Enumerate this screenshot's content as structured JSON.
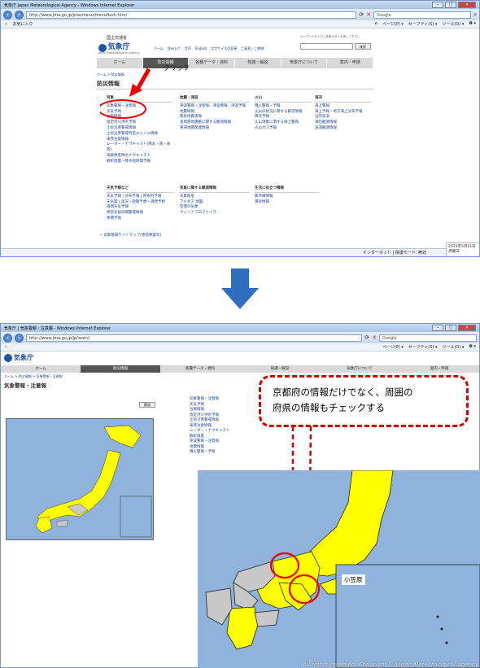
{
  "window1": {
    "title": "気象庁 Japan Meteorological Agency - Windows Internet Explorer",
    "url": "http://www.jma.go.jp/jma/menu/menuflash.html",
    "search_placeholder": "Google",
    "fav_label": "お気に入り",
    "toolbar": [
      "ページ(P) ▾",
      "セーフティ(S) ▾",
      "ツール(O) ▾",
      "❷ ▾"
    ],
    "agency_small": "国土交通省",
    "agency_name": "気象庁",
    "agency_en": "Japan Meteorological Agency",
    "top_links": [
      "ホーム",
      "読み上げ",
      "音声",
      "English",
      "文字サイズの変更",
      "ご意見・ご感想",
      "サイトマップ"
    ],
    "search_hint": "キーワードを入力し検索ボタンを押して下さい",
    "search_button": "検索",
    "menu": [
      "ホーム",
      "防災情報",
      "各種データ・資料",
      "知識・解説",
      "気象庁について",
      "案内・申請"
    ],
    "breadcrumb": "ホーム > 防災情報",
    "page_heading": "防災情報",
    "sections": {
      "weather": {
        "title": "気象",
        "items": [
          "気象警報・注意報",
          "天気予報",
          "台風情報",
          "指定河川洪水予報",
          "土砂災害警戒情報",
          "土砂災害警戒判定メッシュ情報",
          "竜巻注意情報",
          "レーダー・ナウキャスト(降水・雷・竜巻)",
          "高解像度降水ナウキャスト",
          "解析雨量・降水短時間予報"
        ]
      },
      "quake": {
        "title": "地震・津波",
        "items": [
          "津波警報・注意報、津波情報、津波予報",
          "地震情報",
          "緊急地震速報",
          "長周期地震動に関する観測情報",
          "東海地震関連情報"
        ]
      },
      "volcano": {
        "title": "火山",
        "items": [
          "噴火警報・予報",
          "火山の状況に関する解説情報",
          "降灰予報",
          "火山現象に関する海上警報",
          "火山ガス予報"
        ]
      },
      "sea": {
        "title": "海洋",
        "items": [
          "海上警報",
          "海上予報・地方海上分布予報",
          "沿岸波浪",
          "潮位観測情報",
          "波浪観測情報"
        ]
      },
      "forecast": {
        "title": "天気予報など",
        "items": [
          "天気予報 | 分布予報 | 時系列予報",
          "天気図 | 実況・短期予想・週間予想",
          "週間天気予報",
          "異常天候早期警戒情報",
          "季節予報"
        ]
      },
      "obs": {
        "title": "気象に関する観測情報",
        "items": [
          "気象衛星",
          "アメダス 地図",
          "空港の気象",
          "ウィンドプロファイラ"
        ]
      },
      "life": {
        "title": "生活に役立つ情報",
        "items": [
          "紫外線情報",
          "黄砂情報"
        ]
      }
    },
    "footer_link": "» 気象情報サイトマップ(更新頻度別)",
    "status_zone": "インターネット | 保護モード: 無効",
    "date_overlay": "2015年5月11日\n月曜日",
    "annotation_click": "クリック"
  },
  "window2": {
    "title": "気象庁 | 気象警報・注意報 - Windows Internet Explorer",
    "url": "http://www.jma.go.jp/jp/warn/",
    "menu": [
      "ホーム",
      "防災情報",
      "各種データ・資料",
      "知識・解説",
      "気象庁について",
      "案内・申請"
    ],
    "breadcrumb": "ホーム > 防災情報 > 気象警報・注意報",
    "page_title": "気象警報・注意報",
    "info_button": "解説",
    "left_links": [
      "気象警報・注意報",
      "天気予報",
      "台風情報",
      "指定河川洪水予報",
      "土砂災害警戒情報",
      "竜巻注意情報",
      "レーダー・ナウキャスト",
      "解析雨量",
      "津波警報・注意報",
      "地震情報",
      "噴火警報・予報"
    ],
    "callout_line1": "京都府の情報だけでなく、周囲の",
    "callout_line2": "府県の情報もチェックする",
    "zoom_label": "小笠原",
    "copyright": "All rights reserved. Copyright © Japan Meteorological Agency"
  },
  "colors": {
    "warning_yellow": "#ffff00",
    "land_gray": "#c8c8c8",
    "sea_blue": "#8fb3dc",
    "callout_red": "#d40000",
    "arrow_blue": "#2e6fc0"
  }
}
